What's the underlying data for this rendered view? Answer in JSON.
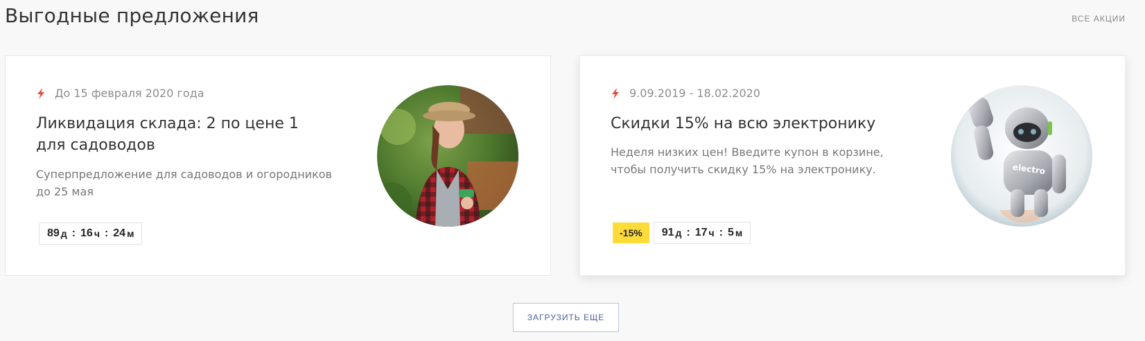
{
  "header": {
    "title": "Выгодные предложения",
    "all_link": "ВСЕ АКЦИИ"
  },
  "offers": [
    {
      "date": "До 15 февраля 2020 года",
      "title": "Ликвидация склада: 2 по цене 1 для садоводов",
      "description": "Суперпредложение для садоводов и огородников до 25 мая",
      "badge": "",
      "timer": {
        "days": "89",
        "days_unit": "д",
        "hours": "16",
        "hours_unit": "ч",
        "minutes": "24",
        "minutes_unit": "м"
      },
      "image": "gardener-woman-photo"
    },
    {
      "date": "9.09.2019 - 18.02.2020",
      "title": "Скидки 15% на всю электронику",
      "description": "Неделя низких цен! Введите купон в корзине, чтобы получить скидку 15% на электронику.",
      "badge": "-15%",
      "timer": {
        "days": "91",
        "days_unit": "д",
        "hours": "17",
        "hours_unit": "ч",
        "minutes": "5",
        "minutes_unit": "м"
      },
      "image": "robot-photo",
      "image_text": "electro"
    }
  ],
  "load_more": "ЗАГРУЗИТЬ ЕЩЕ",
  "colors": {
    "accent_bolt": "#e8473b",
    "badge_bg": "#fddc3a",
    "button_text": "#4a5fa0"
  }
}
